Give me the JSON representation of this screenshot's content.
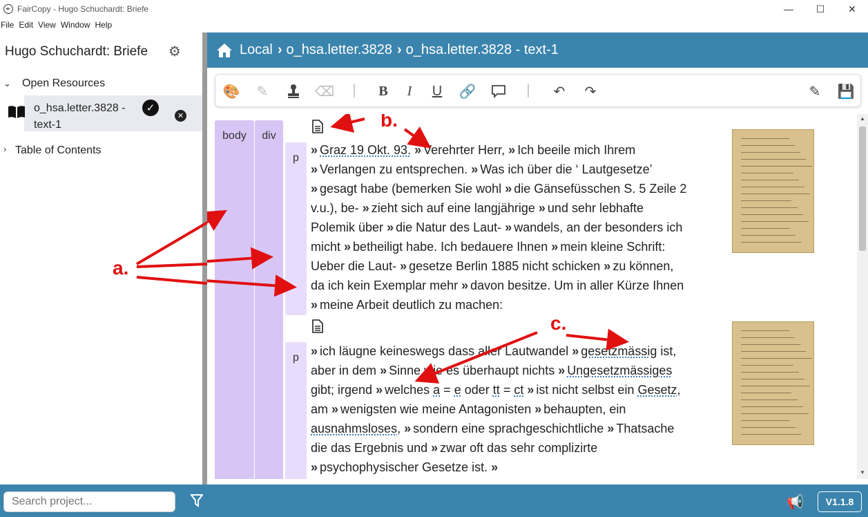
{
  "window": {
    "title": "FairCopy - Hugo Schuchardt: Briefe",
    "minimize": "—",
    "maximize": "☐",
    "close": "✕"
  },
  "menu": [
    "File",
    "Edit",
    "View",
    "Window",
    "Help"
  ],
  "sidebar": {
    "project_title": "Hugo Schuchardt: Briefe",
    "open_resources": "Open Resources",
    "resource_label": "o_hsa.letter.3828 - text-1",
    "table_of_contents": "Table of Contents"
  },
  "breadcrumb": [
    "Local",
    "o_hsa.letter.3828",
    "o_hsa.letter.3828 - text-1"
  ],
  "structure": {
    "body": "body",
    "div": "div",
    "p1": "p",
    "p2": "p"
  },
  "para1": [
    {
      "t": "Graz 19 Okt. 93.",
      "u": true
    },
    {
      "t": "Verehrter Herr,"
    },
    {
      "t": "Ich beeile mich Ihrem"
    },
    {
      "t": "Verlangen zu entsprechen."
    },
    {
      "t": "Was ich über die ‘ Lautgesetze’"
    },
    {
      "t": "gesagt habe (bemerken Sie wohl"
    },
    {
      "t": "die Gänsefüsschen S. 5 Zeile 2 v.u.), be-"
    },
    {
      "t": "zieht sich auf eine langjährige"
    },
    {
      "t": "und sehr lebhafte Polemik über"
    },
    {
      "t": "die Natur des Laut-"
    },
    {
      "t": "wandels, an der besonders ich micht"
    },
    {
      "t": "betheiligt habe. Ich bedauere Ihnen"
    },
    {
      "t": "mein kleine Schrift: Ueber die Laut-"
    },
    {
      "t": "gesetze Berlin 1885 nicht schicken"
    },
    {
      "t": "zu können, da ich kein Exemplar mehr"
    },
    {
      "t": "davon besitze. Um in aller Kürze Ihnen"
    },
    {
      "t": "meine Arbeit deutlich zu machen:"
    }
  ],
  "para2_text": {
    "s1": "ich läugne keineswegs dass aller Lautwandel",
    "w1": "gesetzmässig",
    "s2": "ist, aber in dem",
    "s3": "Sinne wie es überhaupt nichts",
    "w2": "Ungesetzmässiges",
    "s4": "gibt; irgend",
    "s5": "welches",
    "a": "a",
    "eq1": "=",
    "e": "e",
    "oder": "oder",
    "tt": "tt",
    "eq2": "=",
    "ct": "ct",
    "s6": "ist nicht selbst ein",
    "w3": "Gesetz",
    "s7": ", am",
    "s8": "wenigsten wie meine Antagonisten",
    "s9": "behaupten, ein",
    "w4": "ausnahmsloses",
    "s10": ",",
    "s11": "sondern eine sprachgeschichtliche",
    "s12": "Thatsache die das Ergebnis und",
    "s13": "zwar oft das sehr complizirte",
    "s14": "psychophysischer Gesetze ist."
  },
  "annotations": {
    "a": "a.",
    "b": "b.",
    "c": "c."
  },
  "search": {
    "placeholder": "Search project..."
  },
  "version": "V1.1.8",
  "colors": {
    "header": "#3a84ad",
    "struct": "#d7c6f5",
    "struct_p": "#e8dcfc",
    "annotation": "#e01010"
  }
}
